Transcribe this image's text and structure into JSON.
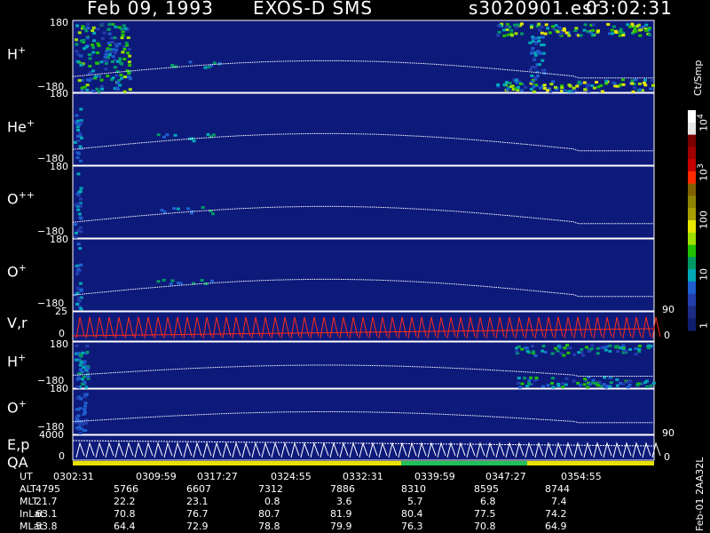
{
  "header": {
    "date": "Feb 09, 1993",
    "instrument": "EXOS-D SMS",
    "file": "s3020901.esr",
    "time": "03:02:31"
  },
  "panels": [
    {
      "species": "H",
      "charge": "+",
      "tick_top": "180",
      "tick_bottom": "−180"
    },
    {
      "species": "He",
      "charge": "+",
      "tick_top": "180",
      "tick_bottom": "−180"
    },
    {
      "species": "O",
      "charge": "++",
      "tick_top": "180",
      "tick_bottom": "−180"
    },
    {
      "species": "O",
      "charge": "+",
      "tick_top": "180",
      "tick_bottom": "−180"
    },
    {
      "species": "V,r",
      "charge": "",
      "tick_top": "25",
      "tick_bottom": "0",
      "right_top": "90",
      "right_bottom": "0"
    },
    {
      "species": "H",
      "charge": "+",
      "tick_top": "180",
      "tick_bottom": "−180"
    },
    {
      "species": "O",
      "charge": "+",
      "tick_top": "180",
      "tick_bottom": "−180"
    },
    {
      "species": "E,p",
      "charge": "",
      "tick_top": "4000",
      "tick_bottom": "0",
      "right_top": "90",
      "right_bottom": "0"
    },
    {
      "species": "QA",
      "charge": ""
    }
  ],
  "colorbar": {
    "unit": "Ct/Smp",
    "labels": [
      {
        "base": "10",
        "exp": "4"
      },
      {
        "base": "10",
        "exp": "3"
      },
      {
        "base": "100",
        "exp": ""
      },
      {
        "base": "10",
        "exp": ""
      },
      {
        "base": "1",
        "exp": ""
      }
    ],
    "colors": [
      "#ffffff",
      "#e8e8e8",
      "#7a0000",
      "#a00000",
      "#c80000",
      "#ff2a00",
      "#806000",
      "#8f8400",
      "#a8a000",
      "#e6e600",
      "#a0e000",
      "#22c000",
      "#009966",
      "#00a8b8",
      "#1e5fcf",
      "#233fae",
      "#1c2c85",
      "#101e6e"
    ]
  },
  "colors": {
    "background": "#000000",
    "panel_fill": "#0d1a7a",
    "trace": "#ffffff",
    "velocity_trace": "#ff2a1a",
    "qa_yellow": "#e8e000",
    "qa_green": "#22c05a"
  },
  "chart_data": {
    "type": "heatmap",
    "x_ticks": [
      "0302:31",
      "0309:59",
      "0317:27",
      "0324:55",
      "0332:31",
      "0339:59",
      "0347:27",
      "0354:55"
    ],
    "y_range_pitch_deg": [
      -180,
      180
    ],
    "rows": [
      {
        "label": "UT",
        "values": [
          "0302:31",
          "0309:59",
          "0317:27",
          "0324:55",
          "0332:31",
          "0339:59",
          "0347:27",
          "0354:55"
        ]
      },
      {
        "label": "ALT",
        "values": [
          "4795",
          "5766",
          "6607",
          "7312",
          "7886",
          "8310",
          "8595",
          "8744"
        ]
      },
      {
        "label": "MLT",
        "values": [
          "21.7",
          "22.2",
          "23.1",
          "0.8",
          "3.6",
          "5.7",
          "6.8",
          "7.4"
        ]
      },
      {
        "label": "InLat",
        "values": [
          "63.1",
          "70.8",
          "76.7",
          "80.7",
          "81.9",
          "80.4",
          "77.5",
          "74.2"
        ]
      },
      {
        "label": "MLat",
        "values": [
          "53.8",
          "64.4",
          "72.9",
          "78.8",
          "79.9",
          "76.3",
          "70.8",
          "64.9"
        ]
      }
    ],
    "footer_tag": "Feb-01 2AA32L"
  }
}
